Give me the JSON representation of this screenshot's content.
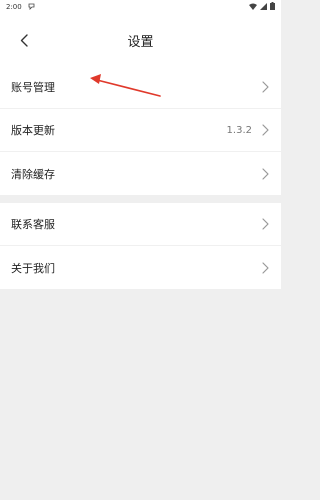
{
  "status_bar": {
    "time": "2:00"
  },
  "header": {
    "title": "设置"
  },
  "section1": {
    "items": [
      {
        "label": "账号管理",
        "value": ""
      },
      {
        "label": "版本更新",
        "value": "1.3.2"
      },
      {
        "label": "清除缓存",
        "value": ""
      }
    ]
  },
  "section2": {
    "items": [
      {
        "label": "联系客服",
        "value": ""
      },
      {
        "label": "关于我们",
        "value": ""
      }
    ]
  },
  "colors": {
    "annotation_arrow": "#e0392b",
    "background": "#efefef",
    "surface": "#ffffff"
  }
}
